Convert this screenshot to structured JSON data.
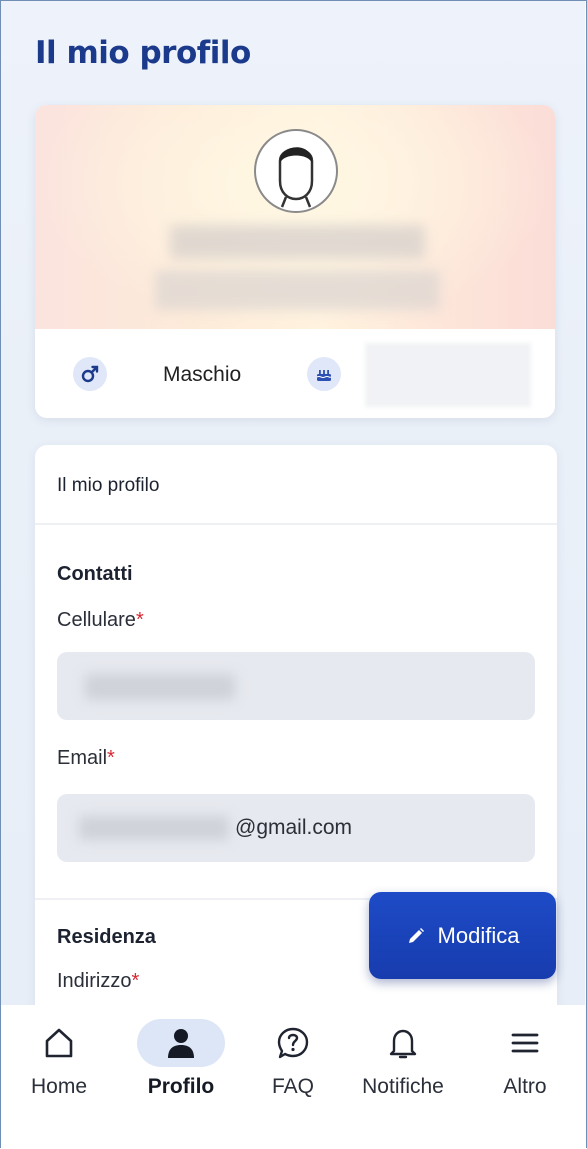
{
  "header": {
    "title": "Il mio profilo"
  },
  "profile": {
    "gender": "Maschio",
    "gender_icon": "male-symbol-icon",
    "birthday_icon": "cake-icon",
    "avatar_icon": "default-avatar-icon"
  },
  "form": {
    "card_title": "Il mio profilo",
    "contacts_section": "Contatti",
    "mobile_label": "Cellulare",
    "email_label": "Email",
    "email_value": "@gmail.com",
    "residence_section": "Residenza",
    "address_label": "Indirizzo",
    "required_marker": "*"
  },
  "fab": {
    "label": "Modifica",
    "icon": "pencil-icon"
  },
  "nav": {
    "items": [
      {
        "label": "Home",
        "icon": "home-icon"
      },
      {
        "label": "Profilo",
        "icon": "person-icon",
        "active": true
      },
      {
        "label": "FAQ",
        "icon": "question-chat-icon"
      },
      {
        "label": "Notifiche",
        "icon": "bell-icon"
      },
      {
        "label": "Altro",
        "icon": "menu-icon"
      }
    ]
  },
  "colors": {
    "primary": "#1c3a8c",
    "fab": "#1e4bc7",
    "required": "#d62834",
    "nav_active_bg": "#dde6f7"
  }
}
